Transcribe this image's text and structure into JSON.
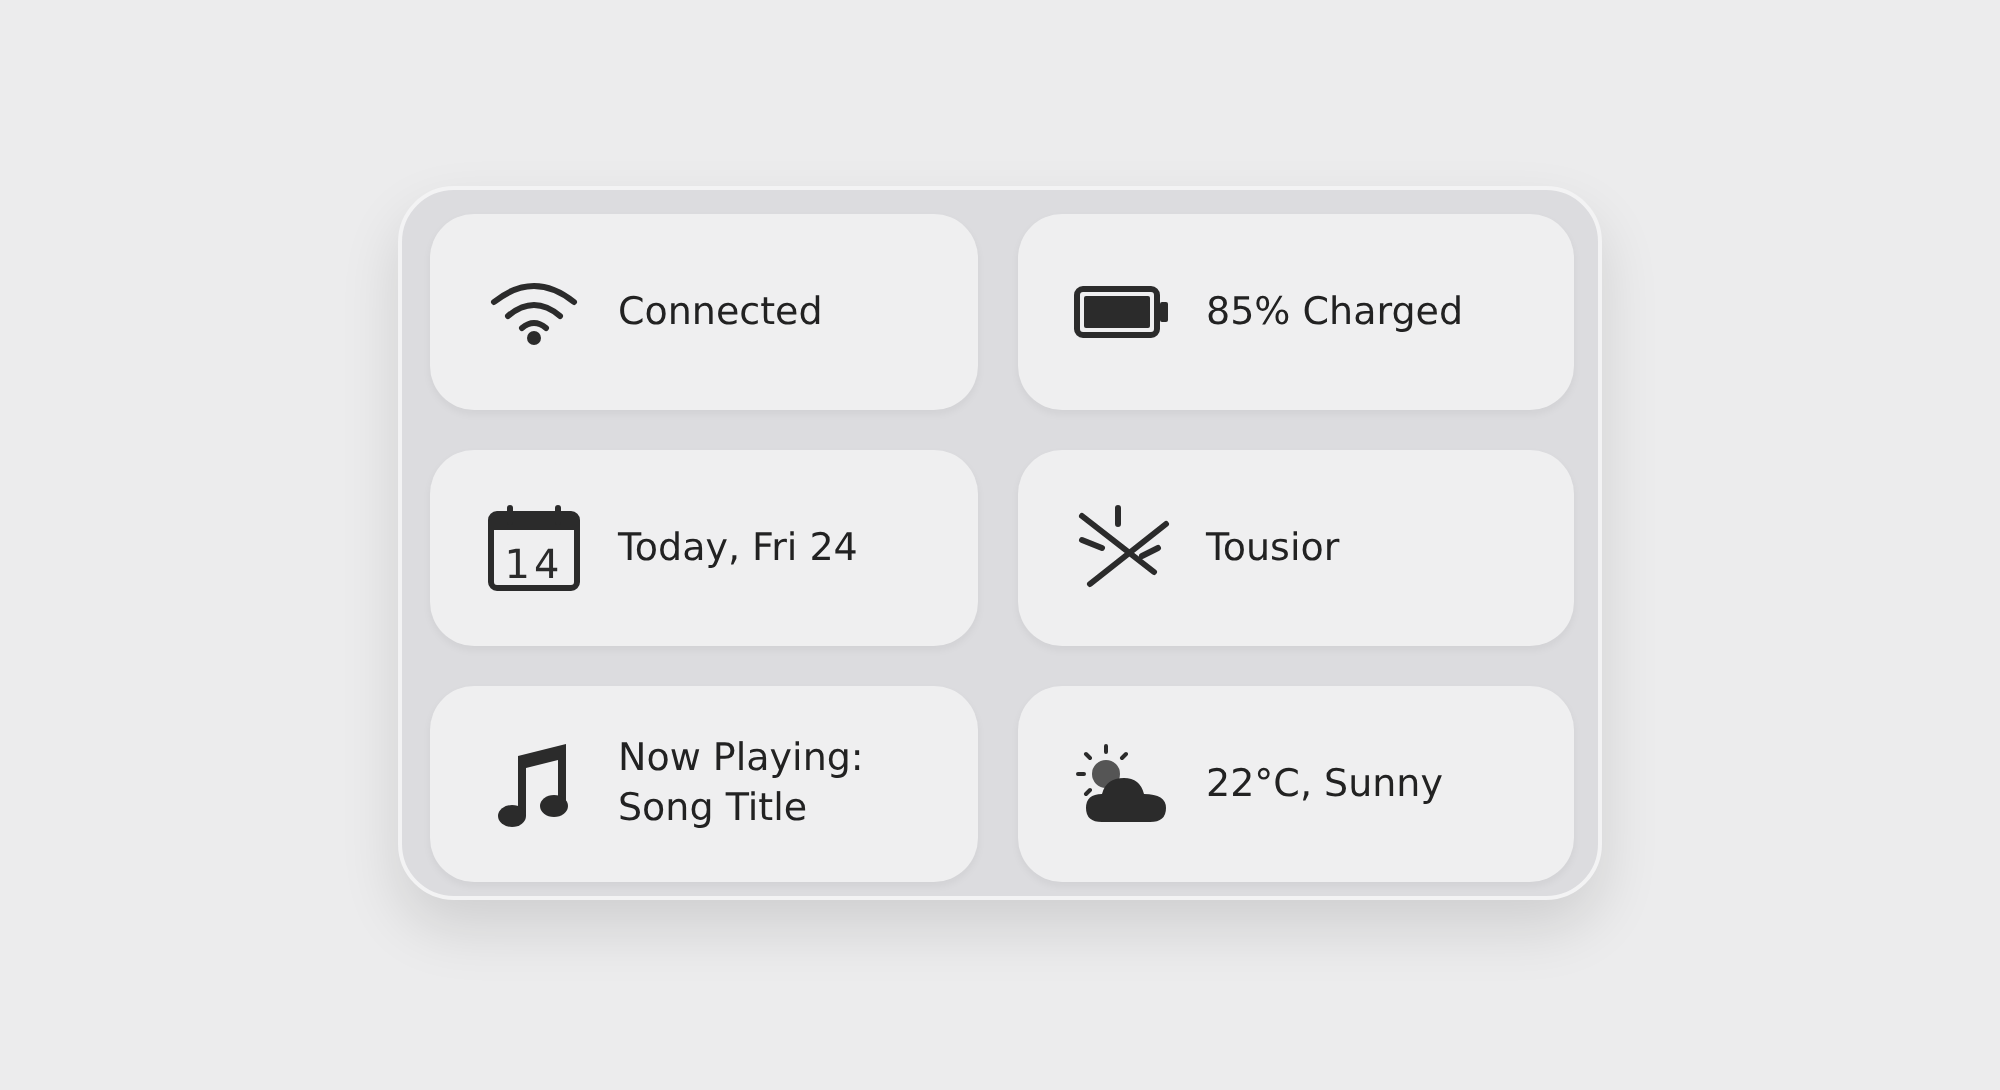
{
  "tiles": [
    {
      "kind": "wifi",
      "lines": [
        "Connected"
      ]
    },
    {
      "kind": "battery",
      "lines": [
        "85% Charged"
      ]
    },
    {
      "kind": "calendar",
      "icon_text": "14",
      "lines": [
        "Today, Fri 24"
      ]
    },
    {
      "kind": "sparkle",
      "lines": [
        "Tousior"
      ]
    },
    {
      "kind": "music",
      "lines": [
        "Now Playing:",
        "Song Title"
      ]
    },
    {
      "kind": "weather",
      "lines": [
        "22°C, Sunny"
      ]
    }
  ]
}
